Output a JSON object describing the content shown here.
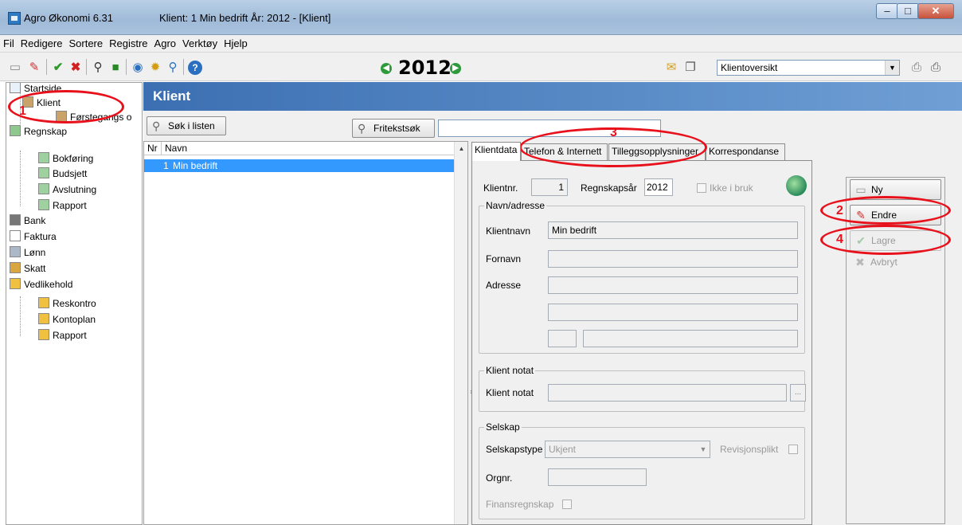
{
  "window": {
    "app_title": "Agro Økonomi 6.31",
    "client_info": "Klient:  1  Min bedrift    År: 2012 - [Klient]"
  },
  "menu": [
    "Fil",
    "Redigere",
    "Sortere",
    "Registre",
    "Agro",
    "Verktøy",
    "Hjelp"
  ],
  "toolbar": {
    "year": "2012",
    "view_select": "Klientoversikt"
  },
  "tree": {
    "items": [
      {
        "label": "Startside",
        "icon": "home-icon"
      },
      {
        "label": "Klient",
        "icon": "client-icon"
      },
      {
        "label": "Førstegangs o",
        "icon": "client-icon"
      },
      {
        "label": "Regnskap",
        "icon": "folder-icon"
      },
      {
        "label": "Bokføring",
        "icon": "document-icon"
      },
      {
        "label": "Budsjett",
        "icon": "document-icon"
      },
      {
        "label": "Avslutning",
        "icon": "document-icon"
      },
      {
        "label": "Rapport",
        "icon": "document-icon"
      },
      {
        "label": "Bank",
        "icon": "calculator-icon"
      },
      {
        "label": "Faktura",
        "icon": "invoice-icon"
      },
      {
        "label": "Lønn",
        "icon": "payroll-icon"
      },
      {
        "label": "Skatt",
        "icon": "tax-icon"
      },
      {
        "label": "Vedlikehold",
        "icon": "maintenance-icon"
      },
      {
        "label": "Reskontro",
        "icon": "document-icon"
      },
      {
        "label": "Kontoplan",
        "icon": "document-icon"
      },
      {
        "label": "Rapport",
        "icon": "document-icon"
      }
    ]
  },
  "main": {
    "title": "Klient",
    "search_button": "Søk i listen",
    "fritekst_button": "Fritekstsøk",
    "list": {
      "columns": [
        "Nr",
        "Navn"
      ],
      "rows": [
        {
          "nr": "1",
          "navn": "Min bedrift"
        }
      ]
    }
  },
  "tabs": [
    "Klientdata",
    "Telefon & Internett",
    "Tilleggsopplysninger",
    "Korrespondanse"
  ],
  "form": {
    "klientnr_label": "Klientnr.",
    "klientnr_value": "1",
    "regnskapsar_label": "Regnskapsår",
    "regnskapsar_value": "2012",
    "ikke_i_bruk_label": "Ikke i bruk",
    "navn_group": "Navn/adresse",
    "klientnavn_label": "Klientnavn",
    "klientnavn_value": "Min bedrift",
    "fornavn_label": "Fornavn",
    "adresse_label": "Adresse",
    "notat_group": "Klient notat",
    "notat_label": "Klient notat",
    "notat_button": "...",
    "selskap_group": "Selskap",
    "selskapstype_label": "Selskapstype",
    "selskapstype_value": "Ukjent",
    "revisjonsplikt_label": "Revisjonsplikt",
    "orgnr_label": "Orgnr.",
    "finansregnskap_label": "Finansregnskap"
  },
  "side_buttons": {
    "ny": "Ny",
    "endre": "Endre",
    "lagre": "Lagre",
    "avbryt": "Avbryt"
  },
  "annotations": [
    "1",
    "2",
    "3",
    "4"
  ],
  "colors": {
    "annotation": "#e8101a",
    "header_blue": "#3c6fb2",
    "selection": "#3399ff"
  }
}
